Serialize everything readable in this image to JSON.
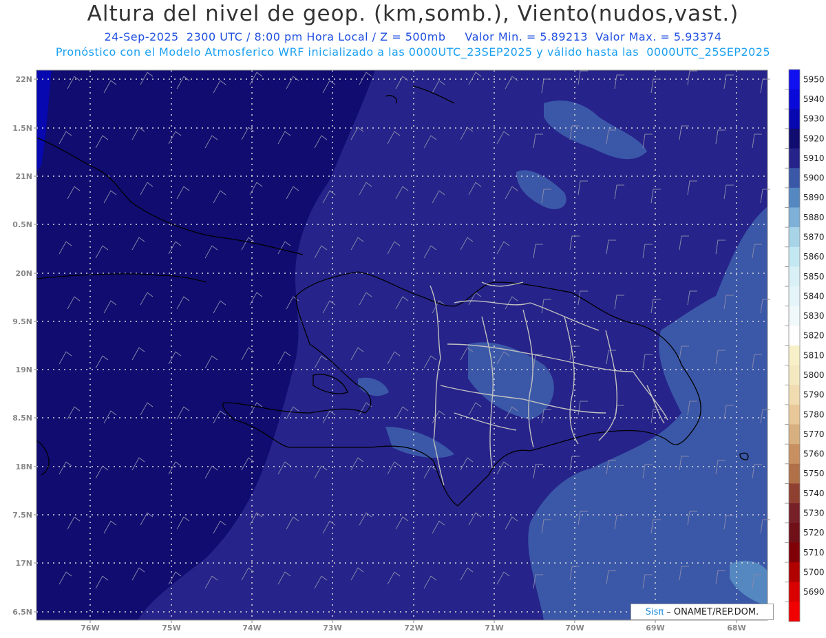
{
  "header": {
    "title": "Altura del nivel de geop. (km,somb.), Viento(nudos,vast.)",
    "subtitle_date": "24-Sep-2025  2300 UTC / 8:00 pm Hora Local / Z = 500mb",
    "subtitle_minmax": "Valor Min. = 5.89213  Valor Max. = 5.93374",
    "forecast_line": "Pronóstico con el Modelo Atmosferico WRF inicializado a las 0000UTC_23SEP2025 y válido hasta las  0000UTC_25SEP2025"
  },
  "axes": {
    "lat_labels": [
      "22N",
      "1.5N",
      "21N",
      "0.5N",
      "20N",
      "9.5N",
      "19N",
      "8.5N",
      "18N",
      "7.5N",
      "17N",
      "6.5N"
    ],
    "lon_labels": [
      "76W",
      "75W",
      "74W",
      "73W",
      "72W",
      "71W",
      "70W",
      "69W",
      "68W"
    ]
  },
  "colorbar": {
    "levels": [
      "5950",
      "5940",
      "5930",
      "5920",
      "5910",
      "5900",
      "5890",
      "5880",
      "5870",
      "5860",
      "5850",
      "5840",
      "5830",
      "5820",
      "5810",
      "5800",
      "5790",
      "5780",
      "5770",
      "5760",
      "5750",
      "5740",
      "5730",
      "5720",
      "5710",
      "5700",
      "5690"
    ],
    "colors": [
      "#1010f0",
      "#0a0ad8",
      "#0808b0",
      "#100c70",
      "#26238a",
      "#3b58a8",
      "#5587c0",
      "#7fb0d8",
      "#a8d4e8",
      "#c4e8f2",
      "#d8f0f6",
      "#e4f4f8",
      "#f0f8fa",
      "#ffffff",
      "#f8f0c8",
      "#f4e8c0",
      "#f0dcb0",
      "#e8c898",
      "#d8b080",
      "#c89060",
      "#b07048",
      "#904030",
      "#782028",
      "#701018",
      "#800008",
      "#b00000",
      "#d80000",
      "#f00000"
    ]
  },
  "credit": {
    "brand": "Sisπ",
    "text": "– ONAMET/REP.DOM."
  }
}
